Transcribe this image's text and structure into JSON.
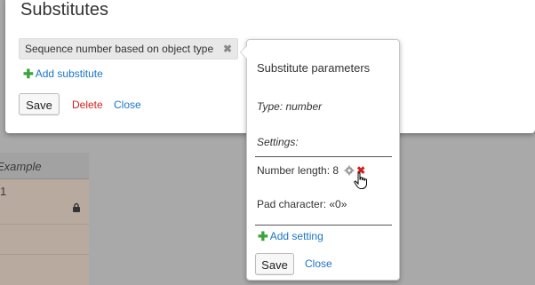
{
  "background": {
    "column_header": "Example",
    "row_value": "1",
    "lock_icon": "lock-icon"
  },
  "dialog": {
    "title": "Substitutes",
    "chip": {
      "label": "Sequence number based on object type",
      "remove_icon": "close-x-icon"
    },
    "add_substitute_label": "Add substitute",
    "save_label": "Save",
    "delete_label": "Delete",
    "close_label": "Close"
  },
  "popover": {
    "title": "Substitute parameters",
    "type_text": "Type: number",
    "settings_label": "Settings:",
    "number_length": "Number length: 8",
    "pad_character": "Pad character: «0»",
    "add_setting_label": "Add setting",
    "save_label": "Save",
    "close_label": "Close"
  },
  "colors": {
    "link": "#1a75c8",
    "danger": "#d02020",
    "add_plus": "#3aa33a",
    "overlay": "#a9a9a9"
  }
}
